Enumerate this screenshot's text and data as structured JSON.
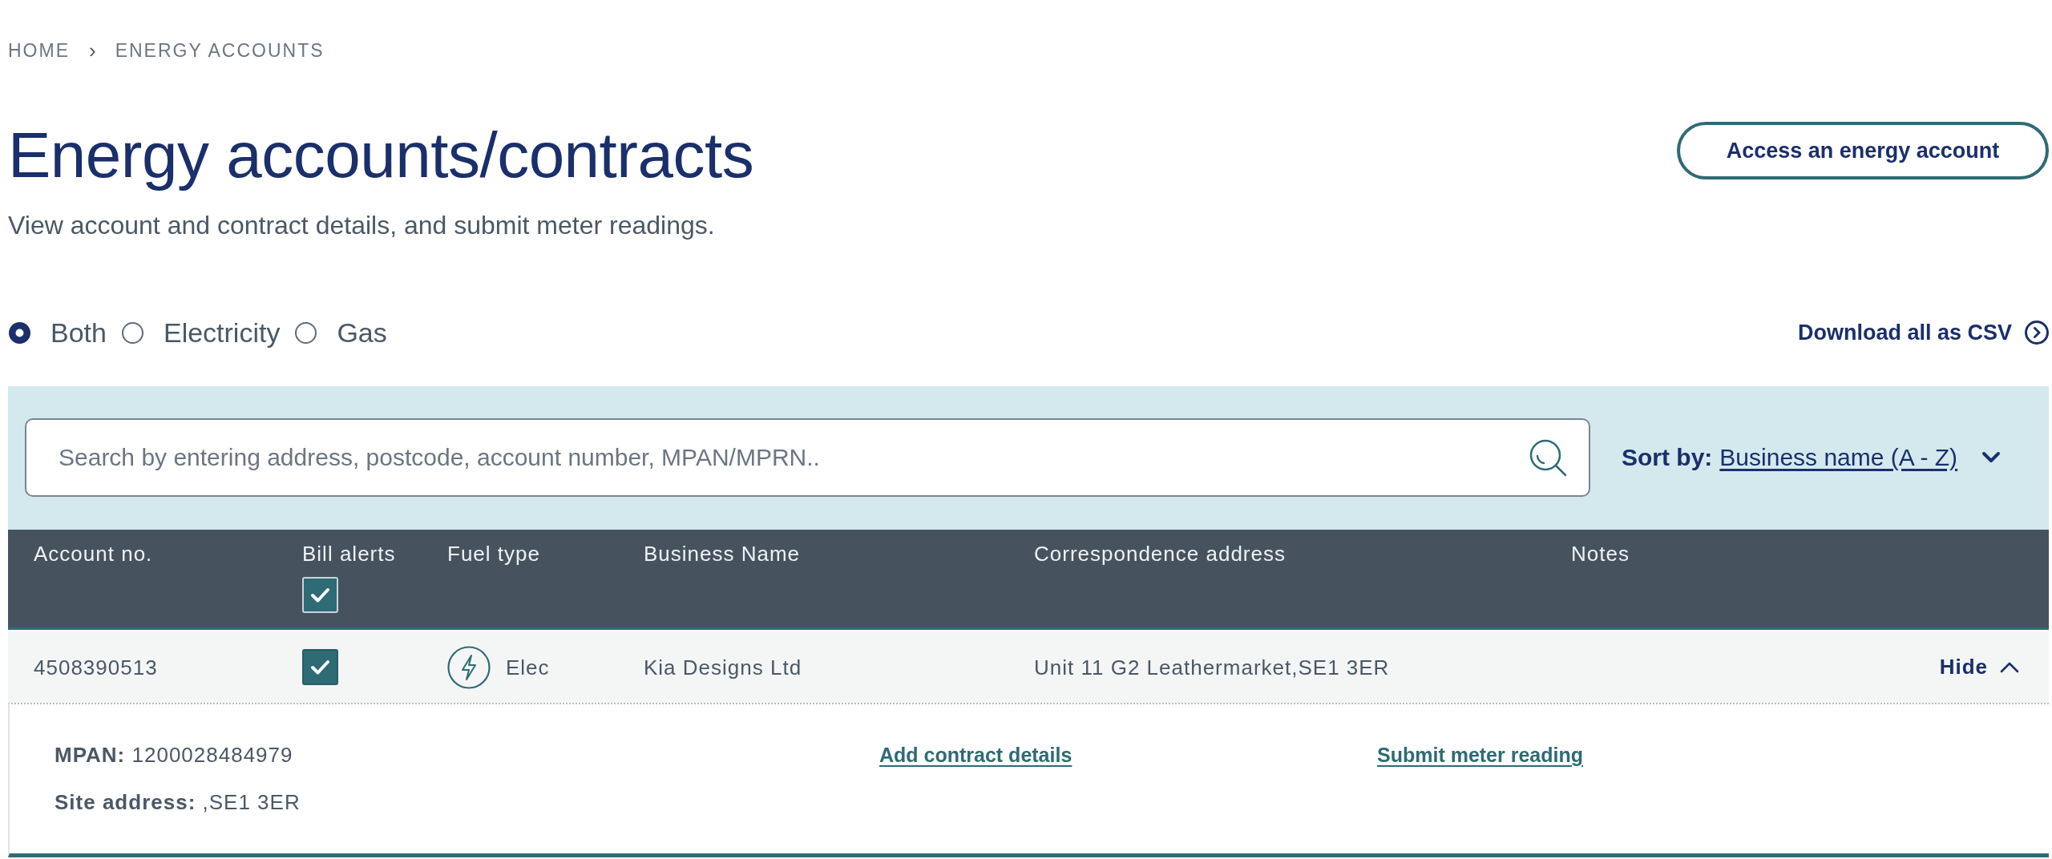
{
  "breadcrumb": {
    "items": [
      "HOME",
      "ENERGY ACCOUNTS"
    ],
    "separator": "›"
  },
  "header": {
    "title": "Energy accounts/contracts",
    "subtitle": "View account and contract details, and submit meter readings.",
    "action_button": "Access an energy account"
  },
  "fuel_filter": [
    {
      "label": "Both",
      "selected": true
    },
    {
      "label": "Electricity",
      "selected": false
    },
    {
      "label": "Gas",
      "selected": false
    }
  ],
  "download_link": "Download all as CSV",
  "search": {
    "placeholder": "Search by entering address, postcode, account number, MPAN/MPRN.."
  },
  "sort": {
    "label": "Sort by:",
    "value": "Business name (A - Z)"
  },
  "table": {
    "columns": [
      {
        "label": "Account no.",
        "kind": "text"
      },
      {
        "label": "Bill alerts",
        "kind": "checkbox",
        "checked": true
      },
      {
        "label": "Fuel type",
        "kind": "text"
      },
      {
        "label": "Business Name",
        "kind": "text"
      },
      {
        "label": "Correspondence address",
        "kind": "text"
      },
      {
        "label": "Notes",
        "kind": "text"
      }
    ],
    "rows": [
      {
        "account_no": "4508390513",
        "checked": true,
        "fuel_type": "Elec",
        "business_name": "Kia Designs Ltd",
        "correspondence_address": "Unit 11 G2 Leathermarket,SE1 3ER",
        "toggle_label": "Hide",
        "expanded": true,
        "details": {
          "fields": [
            {
              "label": "MPAN:",
              "value": "1200028484979"
            },
            {
              "label": "Site address:",
              "value": ",SE1 3ER"
            }
          ],
          "links": [
            "Add contract details",
            "Submit meter reading"
          ]
        }
      }
    ]
  }
}
